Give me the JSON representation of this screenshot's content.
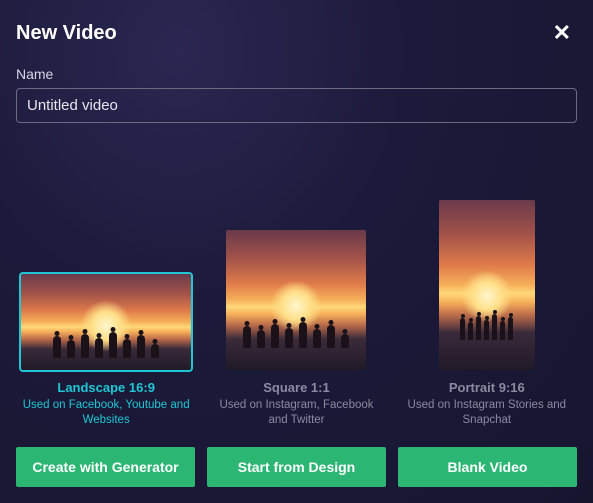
{
  "header": {
    "title": "New Video",
    "close_glyph": "✕"
  },
  "name_field": {
    "label": "Name",
    "value": "Untitled video"
  },
  "ratios": [
    {
      "title": "Landscape 16:9",
      "desc": "Used on Facebook, Youtube and Websites",
      "selected": true
    },
    {
      "title": "Square 1:1",
      "desc": "Used on Instagram, Facebook and Twitter",
      "selected": false
    },
    {
      "title": "Portrait 9:16",
      "desc": "Used on Instagram Stories and Snapchat",
      "selected": false
    }
  ],
  "actions": {
    "create_generator": "Create with Generator",
    "start_design": "Start from Design",
    "blank_video": "Blank Video"
  }
}
